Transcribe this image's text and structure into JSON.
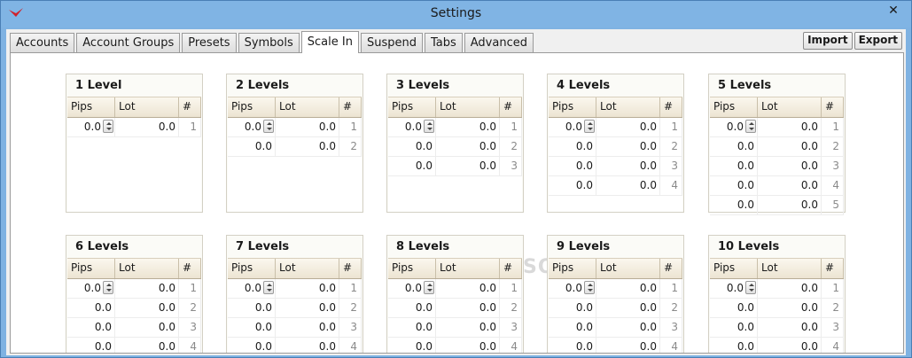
{
  "window": {
    "title": "Settings",
    "close_glyph": "✕"
  },
  "tabs": [
    "Accounts",
    "Account Groups",
    "Presets",
    "Symbols",
    "Scale In",
    "Suspend",
    "Tabs",
    "Advanced"
  ],
  "active_tab": "Scale In",
  "buttons": {
    "import": "Import",
    "export": "Export"
  },
  "columns": {
    "pips": "Pips",
    "lot": "Lot",
    "num": "#"
  },
  "groups": [
    {
      "title": "1 Level",
      "rows": [
        [
          "0.0",
          "0.0",
          "1"
        ]
      ]
    },
    {
      "title": "2 Levels",
      "rows": [
        [
          "0.0",
          "0.0",
          "1"
        ],
        [
          "0.0",
          "0.0",
          "2"
        ]
      ]
    },
    {
      "title": "3 Levels",
      "rows": [
        [
          "0.0",
          "0.0",
          "1"
        ],
        [
          "0.0",
          "0.0",
          "2"
        ],
        [
          "0.0",
          "0.0",
          "3"
        ]
      ]
    },
    {
      "title": "4 Levels",
      "rows": [
        [
          "0.0",
          "0.0",
          "1"
        ],
        [
          "0.0",
          "0.0",
          "2"
        ],
        [
          "0.0",
          "0.0",
          "3"
        ],
        [
          "0.0",
          "0.0",
          "4"
        ]
      ]
    },
    {
      "title": "5 Levels",
      "rows": [
        [
          "0.0",
          "0.0",
          "1"
        ],
        [
          "0.0",
          "0.0",
          "2"
        ],
        [
          "0.0",
          "0.0",
          "3"
        ],
        [
          "0.0",
          "0.0",
          "4"
        ],
        [
          "0.0",
          "0.0",
          "5"
        ]
      ]
    },
    {
      "title": "6 Levels",
      "rows": [
        [
          "0.0",
          "0.0",
          "1"
        ],
        [
          "0.0",
          "0.0",
          "2"
        ],
        [
          "0.0",
          "0.0",
          "3"
        ],
        [
          "0.0",
          "0.0",
          "4"
        ]
      ]
    },
    {
      "title": "7 Levels",
      "rows": [
        [
          "0.0",
          "0.0",
          "1"
        ],
        [
          "0.0",
          "0.0",
          "2"
        ],
        [
          "0.0",
          "0.0",
          "3"
        ],
        [
          "0.0",
          "0.0",
          "4"
        ]
      ]
    },
    {
      "title": "8 Levels",
      "rows": [
        [
          "0.0",
          "0.0",
          "1"
        ],
        [
          "0.0",
          "0.0",
          "2"
        ],
        [
          "0.0",
          "0.0",
          "3"
        ],
        [
          "0.0",
          "0.0",
          "4"
        ]
      ]
    },
    {
      "title": "9 Levels",
      "rows": [
        [
          "0.0",
          "0.0",
          "1"
        ],
        [
          "0.0",
          "0.0",
          "2"
        ],
        [
          "0.0",
          "0.0",
          "3"
        ],
        [
          "0.0",
          "0.0",
          "4"
        ]
      ]
    },
    {
      "title": "10 Levels",
      "rows": [
        [
          "0.0",
          "0.0",
          "1"
        ],
        [
          "0.0",
          "0.0",
          "2"
        ],
        [
          "0.0",
          "0.0",
          "3"
        ],
        [
          "0.0",
          "0.0",
          "4"
        ]
      ]
    }
  ],
  "watermark": "SOFTPEDIA"
}
